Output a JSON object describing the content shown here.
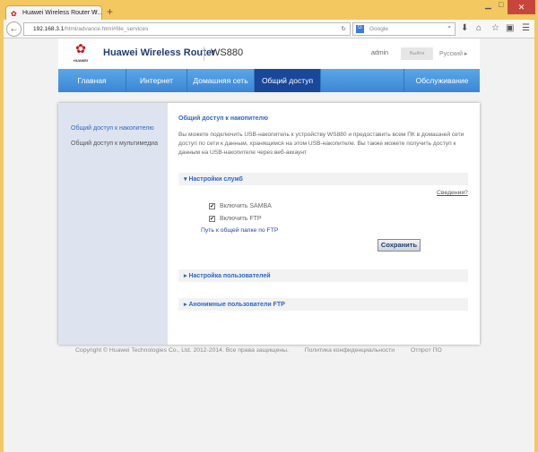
{
  "browser": {
    "tab_title": "Huawei Wireless Router W...",
    "url_host": "192.168.3.1",
    "url_path": "/html/advance.html#file_services",
    "search_placeholder": "Google",
    "search_engine": "G"
  },
  "header": {
    "logo_text": "HUAWEI",
    "title": "Huawei Wireless Router",
    "model": "WS880",
    "user": "admin",
    "logout": "Выйти",
    "language": "Русский"
  },
  "menu": [
    {
      "label": "Главная"
    },
    {
      "label": "Интернет"
    },
    {
      "label": "Домашняя сеть"
    },
    {
      "label": "Общий доступ",
      "active": true
    },
    {
      "label": ""
    },
    {
      "label": "Обслуживание"
    }
  ],
  "sidebar": [
    {
      "label": "Общий доступ к накопителю",
      "active": true
    },
    {
      "label": "Общий доступ к мультимедиа"
    }
  ],
  "main": {
    "title": "Общий доступ к накопителю",
    "description": "Вы можете подключить USB-накопитель к устройству WS880 и предоставить всем ПК в домашней сети доступ по сети к данным, хранящимся на этом USB-накопителе. Вы также можете получить доступ к данным на USB-накопителе через веб-аккаунт",
    "service_section": "Настройки служб",
    "help_link": "Сведения?",
    "samba_label": "Включить SAMBA",
    "samba_checked": true,
    "ftp_label": "Включить FTP",
    "ftp_checked": true,
    "ftp_path_link": "Путь к общей папке по FTP",
    "save": "Сохранить",
    "users_section": "Настройка пользователей",
    "anon_section": "Анонимные пользователи FTP"
  },
  "footer": {
    "copyright": "Copyright © Huawei Technologies Co., Ltd. 2012-2014. Все права защищены.",
    "privacy": "Политика конфиденциальности",
    "oss": "Отпрoт ПО"
  }
}
